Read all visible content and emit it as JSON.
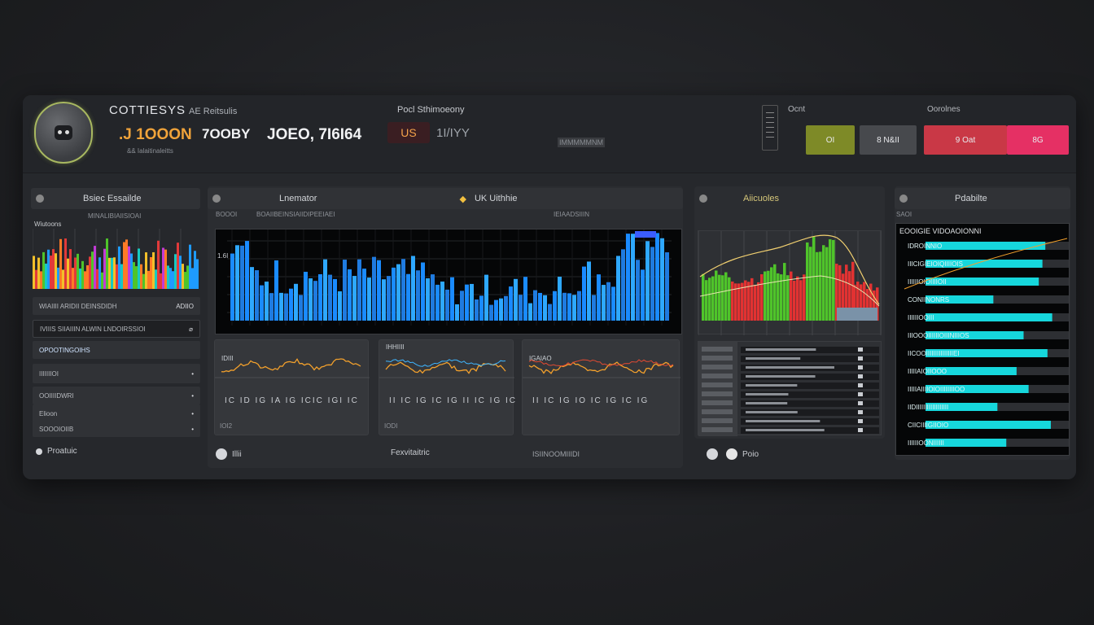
{
  "header": {
    "brand": "COTTIESYS",
    "brand_sub": "AE Reitsulis",
    "stats": [
      ".J 1OOON",
      "7OOBY",
      "JOEO, 7I6I64"
    ],
    "stat_caption": "&&  Ialaitinaleitts",
    "center_label": "Pocl Sthimoeony",
    "badge": "US",
    "mini_stat": "1I/IYY",
    "mini_bar": "IMMMMMNM",
    "control_label_1": "Ocnt",
    "control_label_2": "Oorolnes",
    "buttons": [
      "OI",
      "8 N&II",
      "9 Oat",
      "8G"
    ]
  },
  "left_panel": {
    "title": "Bsiec Essailde",
    "sub1": "MINALIBIAIISIOAI",
    "sub2": "Wiutoons",
    "rows": [
      {
        "label": "WIAIIII ARIDII DEINSDIDH",
        "right": "ADIIO"
      },
      {
        "label": "IVIIIS SIIAIIIN ALWIN LNDOIRSSIOI",
        "right": "⌀"
      },
      {
        "label": "OPOOTINGOIHS",
        "right": ""
      },
      {
        "label": "IIIIIIIOI",
        "right": "•"
      },
      {
        "label": "OOIIIIDWRI",
        "right": "•"
      },
      {
        "label": "Elioon",
        "right": "•"
      },
      {
        "label": "SOOOIOIIB",
        "right": "•"
      }
    ],
    "footer": "Proatuic"
  },
  "main_panel": {
    "title": "Lnemator",
    "title2": "UK  Uithhie",
    "sub_left": "BOOOI",
    "sub_mid": "BOAIIBEINSIAIIDIPEEIAEI",
    "sub_right": "IEIAADSIIIN",
    "y_label": "1.6I",
    "minis": [
      {
        "label": "IDIII",
        "ticks": "IC  ID  IG  IA  IG  ICIC  IGI  IC",
        "foot": "IOI2"
      },
      {
        "label": "IHHIIII",
        "ticks": "II  IC  IG  IC  IG  II  IC  IG  IC",
        "foot": "IODI"
      },
      {
        "label": "IGAIAO",
        "ticks": "II  IC  IG  IO  IC  IG  IC  IG",
        "foot": ""
      }
    ],
    "footer_left": "Illii",
    "footer_center": "Fexvitaitric",
    "footer_right": "ISIINOOMIIIDI"
  },
  "right_panel": {
    "title": "Aiicuoles",
    "footer": "Poio"
  },
  "far_right_panel": {
    "title": "Pdabilte",
    "sub": "SAOI",
    "header_label": "EOOIGIE  VIDOAOIONNI",
    "rows": [
      "IDROINNIO",
      "IIICIGIEIOIQIIIIOIS",
      "IIIIIIOIOIIIIOII",
      "CONIINONRS",
      "IIIIIIOOIII",
      "IIIOOOIIIIIIOIIINIIIOS",
      "IICOOIIIIIIIIIIIIIIIEI",
      "IIIIIAIOIIOOO",
      "IIIIIAIIIIOIOIIIIIIIIOO",
      "IIDIIIIIIIIIIIIIIIIII",
      "CIICIIIIGIIOIO",
      "IIIIIIOONIIIIII"
    ]
  },
  "colors": {
    "accent_cyan": "#16d7dc",
    "bar_blue": "#1e9bff",
    "bar_green": "#4fc42a",
    "bar_red": "#e23232",
    "button_olive": "#7e8a27",
    "button_red": "#c93846",
    "button_pink": "#e53064"
  }
}
